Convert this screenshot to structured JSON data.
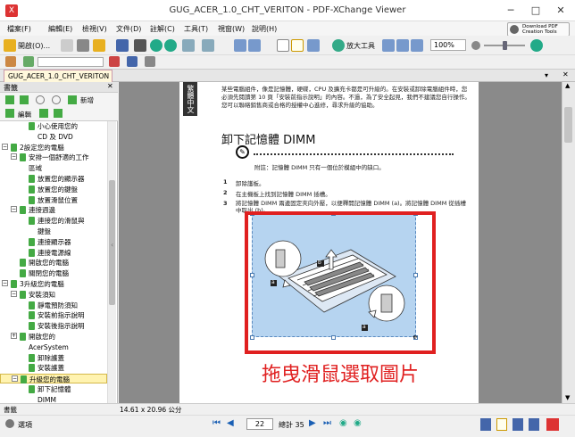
{
  "window": {
    "title": "GUG_ACER_1.0_CHT_VERITON - PDF-XChange Viewer",
    "minimize": "─",
    "maximize": "□",
    "close": "✕"
  },
  "menu": [
    "檔案(F)",
    "編輯(E)",
    "檢視(V)",
    "文件(D)",
    "註解(C)",
    "工具(T)",
    "視窗(W)",
    "說明(H)"
  ],
  "toolbar": {
    "open_label": "開啟(O)...",
    "zoom_tool_label": "放大工具",
    "zoom_value": "100%",
    "download_label_1": "Download PDF",
    "download_label_2": "Creation Tools"
  },
  "tab": {
    "label": "GUG_ACER_1.0_CHT_VERITON"
  },
  "sidepanel": {
    "header": "書籤",
    "new_label": "新增",
    "edit_label": "編輯",
    "bookmarks": [
      {
        "label": "小心使用您的",
        "indent": 2,
        "icon": true
      },
      {
        "label": "CD 及 DVD",
        "indent": 2,
        "icon": false
      },
      {
        "label": "2設定您的電腦",
        "indent": 0,
        "icon": true,
        "expander": "⊟"
      },
      {
        "label": "安排一個舒適的工作",
        "indent": 1,
        "icon": true,
        "expander": "⊟"
      },
      {
        "label": "區域",
        "indent": 1,
        "icon": false
      },
      {
        "label": "放置您的顯示器",
        "indent": 2,
        "icon": true
      },
      {
        "label": "放置您的鍵盤",
        "indent": 2,
        "icon": true
      },
      {
        "label": "放置滑鼠位置",
        "indent": 2,
        "icon": true
      },
      {
        "label": "連接週邊",
        "indent": 1,
        "icon": true,
        "expander": "⊟"
      },
      {
        "label": "連接您的滑鼠與",
        "indent": 2,
        "icon": true
      },
      {
        "label": "鍵盤",
        "indent": 2,
        "icon": false
      },
      {
        "label": "連接顯示器",
        "indent": 2,
        "icon": true
      },
      {
        "label": "連接電源線",
        "indent": 2,
        "icon": true
      },
      {
        "label": "開啟您的電腦",
        "indent": 1,
        "icon": true
      },
      {
        "label": "關閉您的電腦",
        "indent": 1,
        "icon": true
      },
      {
        "label": "3升級您的電腦",
        "indent": 0,
        "icon": true,
        "expander": "⊟"
      },
      {
        "label": "安裝須知",
        "indent": 1,
        "icon": true,
        "expander": "⊟"
      },
      {
        "label": "靜電預防須知",
        "indent": 2,
        "icon": true
      },
      {
        "label": "安裝前指示說明",
        "indent": 2,
        "icon": true
      },
      {
        "label": "安裝後指示說明",
        "indent": 2,
        "icon": true
      },
      {
        "label": "開啟您的",
        "indent": 1,
        "icon": true,
        "expander": "⊞"
      },
      {
        "label": "AcerSystem",
        "indent": 1,
        "icon": false
      },
      {
        "label": "卸除護蓋",
        "indent": 2,
        "icon": true
      },
      {
        "label": "安裝護蓋",
        "indent": 2,
        "icon": true
      },
      {
        "label": "升級您的電腦",
        "indent": 1,
        "icon": true,
        "expander": "⊟",
        "selected": true
      },
      {
        "label": "卸下記憶體",
        "indent": 2,
        "icon": true
      },
      {
        "label": "DIMM",
        "indent": 2,
        "icon": false
      }
    ]
  },
  "page": {
    "side_tab": "繁體中文",
    "intro": "某些電腦組件，像是記憶體，硬碟，CPU 及擴充卡都是可升級的。在安裝或卸除電腦組件時，您必須先閱讀第 10 頁「安裝前指示說明」的內容。不過，為了安全起見，我們不建議您自行操作。您可以聯絡銷售商或合格的授權中心進修，尋求升級的協助。",
    "heading": "卸下記憶體 DIMM",
    "note": "附註：記憶體 DIMM 只有一個位於模組中的缺口。",
    "steps": [
      {
        "num": "1",
        "text": "卸除護板。"
      },
      {
        "num": "2",
        "text": "在主機板上找到記憶體 DIMM 插槽。"
      },
      {
        "num": "3",
        "text": "將記憶體 DIMM 兩邊固定夾向外壓，以便釋開記憶體 DIMM (a)。將記憶體 DIMM 從插槽中取出 (b)。"
      }
    ],
    "labels": {
      "a1": "a",
      "a2": "a",
      "b": "b"
    },
    "caption": "拖曳滑鼠選取圖片"
  },
  "status": {
    "size": "14.61 x 20.96 公分"
  },
  "nav": {
    "options": "選項",
    "page": "22",
    "total": "總計 35"
  },
  "colors": {
    "accent_red": "#e02020",
    "selection": "#b6d4f0"
  }
}
